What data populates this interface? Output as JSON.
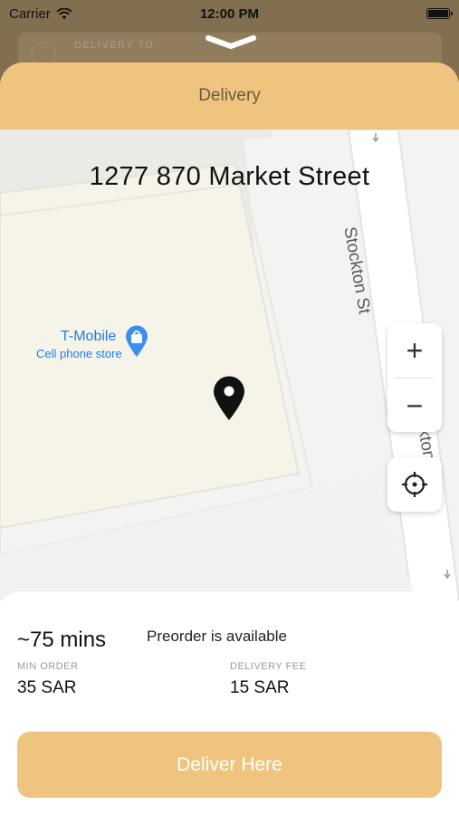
{
  "status_bar": {
    "carrier": "Carrier",
    "time": "12:00 PM"
  },
  "background": {
    "card_label": "DELIVERY TO"
  },
  "sheet": {
    "title": "Delivery"
  },
  "map": {
    "address": "1277 870 Market Street",
    "street_name": "Stockton St",
    "street_name_partial": "kton",
    "poi": {
      "name": "T-Mobile",
      "category": "Cell phone store"
    },
    "zoom_in_label": "+",
    "zoom_out_label": "−"
  },
  "info": {
    "eta": "~75 mins",
    "preorder_text": "Preorder is available",
    "min_order_label": "MIN ORDER",
    "min_order_value": "35 SAR",
    "delivery_fee_label": "DELIVERY FEE",
    "delivery_fee_value": "15 SAR"
  },
  "actions": {
    "deliver_label": "Deliver Here"
  },
  "colors": {
    "accent": "#efc47f",
    "poi_blue": "#1f7de6"
  },
  "icons": [
    "wifi-icon",
    "battery-icon",
    "chevron-down-icon",
    "location-pin-icon",
    "poi-bag-icon",
    "locate-crosshair-icon"
  ]
}
